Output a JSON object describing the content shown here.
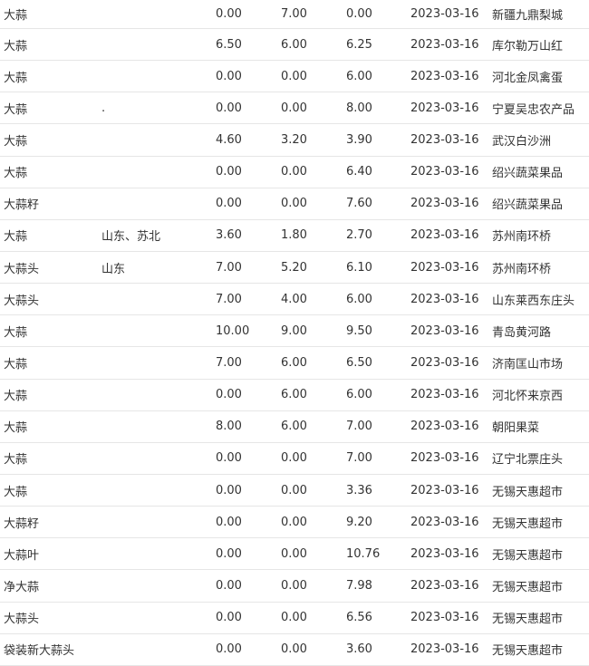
{
  "rows": [
    {
      "name": "大蒜",
      "origin": "",
      "low": "0.00",
      "high": "7.00",
      "avg": "0.00",
      "date": "2023-03-16",
      "market": "新疆九鼎梨城"
    },
    {
      "name": "大蒜",
      "origin": "",
      "low": "6.50",
      "high": "6.00",
      "avg": "6.25",
      "date": "2023-03-16",
      "market": "库尔勒万山红"
    },
    {
      "name": "大蒜",
      "origin": "",
      "low": "0.00",
      "high": "0.00",
      "avg": "6.00",
      "date": "2023-03-16",
      "market": "河北金凤禽蛋"
    },
    {
      "name": "大蒜",
      "origin": ".",
      "low": "0.00",
      "high": "0.00",
      "avg": "8.00",
      "date": "2023-03-16",
      "market": "宁夏吴忠农产品"
    },
    {
      "name": "大蒜",
      "origin": "",
      "low": "4.60",
      "high": "3.20",
      "avg": "3.90",
      "date": "2023-03-16",
      "market": "武汉白沙洲"
    },
    {
      "name": "大蒜",
      "origin": "",
      "low": "0.00",
      "high": "0.00",
      "avg": "6.40",
      "date": "2023-03-16",
      "market": "绍兴蔬菜果品"
    },
    {
      "name": "大蒜籽",
      "origin": "",
      "low": "0.00",
      "high": "0.00",
      "avg": "7.60",
      "date": "2023-03-16",
      "market": "绍兴蔬菜果品"
    },
    {
      "name": "大蒜",
      "origin": "山东、苏北",
      "low": "3.60",
      "high": "1.80",
      "avg": "2.70",
      "date": "2023-03-16",
      "market": "苏州南环桥"
    },
    {
      "name": "大蒜头",
      "origin": "山东",
      "low": "7.00",
      "high": "5.20",
      "avg": "6.10",
      "date": "2023-03-16",
      "market": "苏州南环桥"
    },
    {
      "name": "大蒜头",
      "origin": "",
      "low": "7.00",
      "high": "4.00",
      "avg": "6.00",
      "date": "2023-03-16",
      "market": "山东莱西东庄头"
    },
    {
      "name": "大蒜",
      "origin": "",
      "low": "10.00",
      "high": "9.00",
      "avg": "9.50",
      "date": "2023-03-16",
      "market": "青岛黄河路"
    },
    {
      "name": "大蒜",
      "origin": "",
      "low": "7.00",
      "high": "6.00",
      "avg": "6.50",
      "date": "2023-03-16",
      "market": "济南匡山市场"
    },
    {
      "name": "大蒜",
      "origin": "",
      "low": "0.00",
      "high": "6.00",
      "avg": "6.00",
      "date": "2023-03-16",
      "market": "河北怀来京西"
    },
    {
      "name": "大蒜",
      "origin": "",
      "low": "8.00",
      "high": "6.00",
      "avg": "7.00",
      "date": "2023-03-16",
      "market": "朝阳果菜"
    },
    {
      "name": "大蒜",
      "origin": "",
      "low": "0.00",
      "high": "0.00",
      "avg": "7.00",
      "date": "2023-03-16",
      "market": "辽宁北票庄头"
    },
    {
      "name": "大蒜",
      "origin": "",
      "low": "0.00",
      "high": "0.00",
      "avg": "3.36",
      "date": "2023-03-16",
      "market": "无锡天惠超市"
    },
    {
      "name": "大蒜籽",
      "origin": "",
      "low": "0.00",
      "high": "0.00",
      "avg": "9.20",
      "date": "2023-03-16",
      "market": "无锡天惠超市"
    },
    {
      "name": "大蒜叶",
      "origin": "",
      "low": "0.00",
      "high": "0.00",
      "avg": "10.76",
      "date": "2023-03-16",
      "market": "无锡天惠超市"
    },
    {
      "name": "净大蒜",
      "origin": "",
      "low": "0.00",
      "high": "0.00",
      "avg": "7.98",
      "date": "2023-03-16",
      "market": "无锡天惠超市"
    },
    {
      "name": "大蒜头",
      "origin": "",
      "low": "0.00",
      "high": "0.00",
      "avg": "6.56",
      "date": "2023-03-16",
      "market": "无锡天惠超市"
    },
    {
      "name": "袋装新大蒜头",
      "origin": "",
      "low": "0.00",
      "high": "0.00",
      "avg": "3.60",
      "date": "2023-03-16",
      "market": "无锡天惠超市"
    }
  ]
}
